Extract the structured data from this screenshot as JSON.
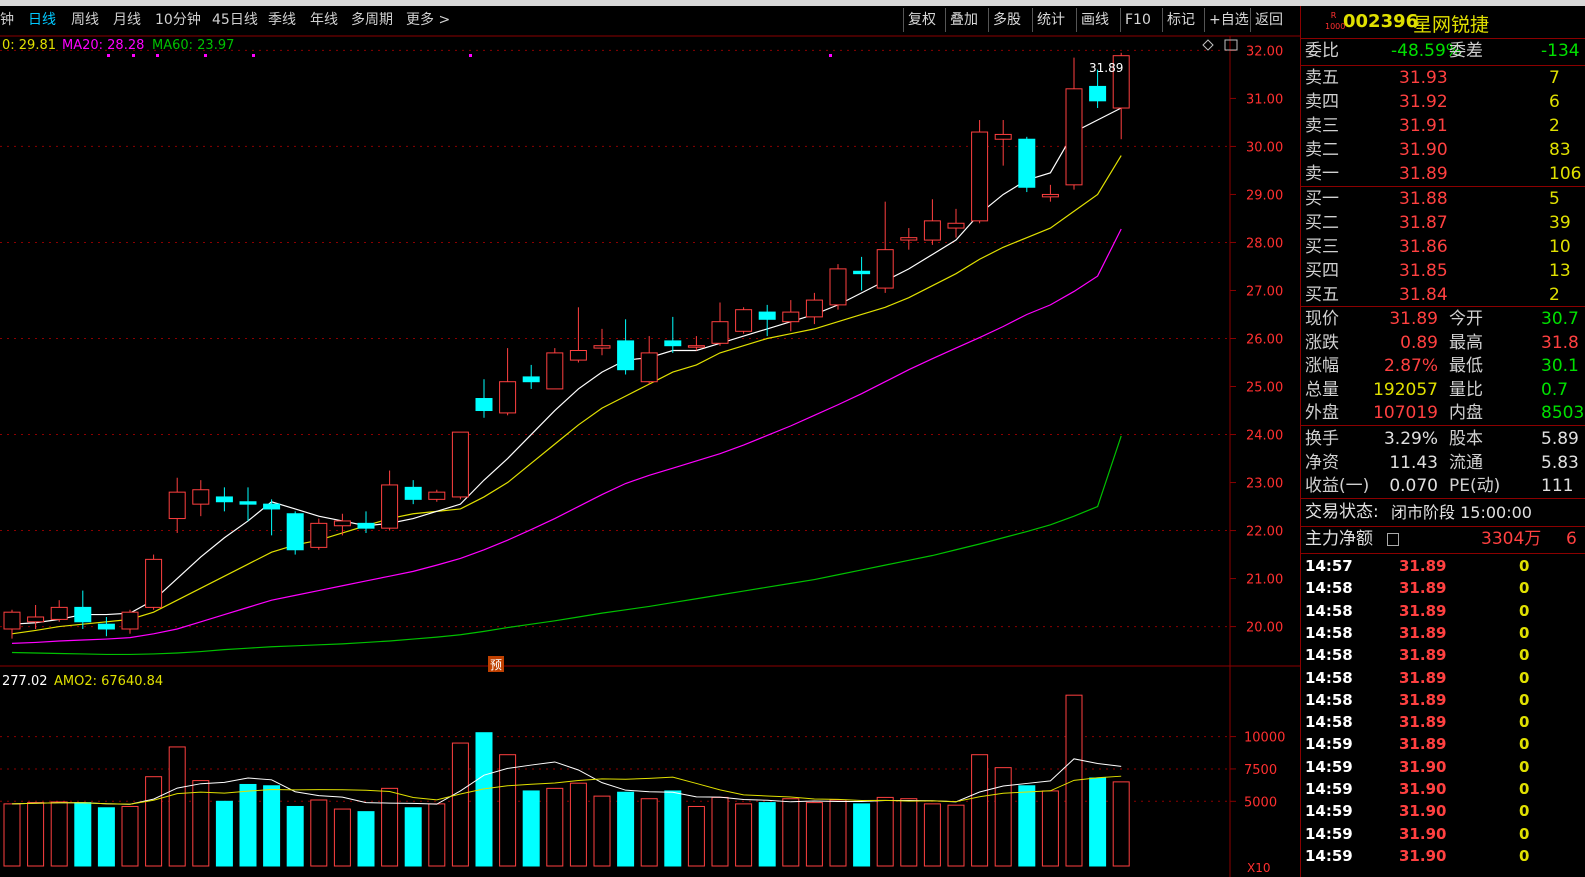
{
  "toolbar": {
    "periods": [
      "分钟",
      "日线",
      "周线",
      "月线",
      "10分钟",
      "45日线",
      "季线",
      "年线",
      "多周期",
      "更多 >"
    ],
    "active_period": "日线",
    "buttons": [
      "复权",
      "叠加",
      "多股",
      "统计",
      "画线",
      "F10",
      "标记",
      "+自选",
      "返回"
    ]
  },
  "indicators": {
    "ma10": "0: 29.81",
    "ma20": "MA20: 28.28",
    "ma60": "MA60: 23.97",
    "volume_legend_a": "277.02",
    "volume_legend_b": "AMO2: 67640.84",
    "yu_marker": "预",
    "high_label": "31.89",
    "x10_label": "X10"
  },
  "colors": {
    "up": "#ff4040",
    "down": "#00ffff",
    "ma5": "#ffffff",
    "ma10": "#e0e000",
    "ma20": "#ff00ff",
    "ma60": "#00c000",
    "grid": "#8b0000",
    "axis_text": "#ff3030"
  },
  "price_axis": [
    "32.00",
    "31.00",
    "30.00",
    "29.00",
    "28.00",
    "27.00",
    "26.00",
    "25.00",
    "24.00",
    "23.00",
    "22.00",
    "21.00",
    "20.00"
  ],
  "volume_axis": [
    "10000",
    "7500",
    "5000"
  ],
  "chart_data": {
    "type": "candlestick",
    "ylim": [
      19.2,
      32.3
    ],
    "candles": [
      {
        "o": 19.95,
        "c": 20.3,
        "h": 20.35,
        "l": 19.75
      },
      {
        "o": 20.1,
        "c": 20.2,
        "h": 20.45,
        "l": 19.95
      },
      {
        "o": 20.15,
        "c": 20.4,
        "h": 20.55,
        "l": 20.1
      },
      {
        "o": 20.4,
        "c": 20.1,
        "h": 20.75,
        "l": 19.95
      },
      {
        "o": 20.05,
        "c": 19.95,
        "h": 20.2,
        "l": 19.8
      },
      {
        "o": 19.95,
        "c": 20.3,
        "h": 20.35,
        "l": 19.85
      },
      {
        "o": 20.4,
        "c": 21.4,
        "h": 21.5,
        "l": 20.35
      },
      {
        "o": 22.25,
        "c": 22.8,
        "h": 23.1,
        "l": 21.95
      },
      {
        "o": 22.55,
        "c": 22.85,
        "h": 23.05,
        "l": 22.3
      },
      {
        "o": 22.7,
        "c": 22.6,
        "h": 22.9,
        "l": 22.4
      },
      {
        "o": 22.6,
        "c": 22.55,
        "h": 22.9,
        "l": 22.2
      },
      {
        "o": 22.55,
        "c": 22.45,
        "h": 22.65,
        "l": 21.9
      },
      {
        "o": 22.35,
        "c": 21.6,
        "h": 22.4,
        "l": 21.5
      },
      {
        "o": 21.65,
        "c": 22.15,
        "h": 22.25,
        "l": 21.6
      },
      {
        "o": 22.1,
        "c": 22.2,
        "h": 22.35,
        "l": 21.9
      },
      {
        "o": 22.15,
        "c": 22.05,
        "h": 22.4,
        "l": 21.95
      },
      {
        "o": 22.05,
        "c": 22.95,
        "h": 23.25,
        "l": 22.0
      },
      {
        "o": 22.9,
        "c": 22.65,
        "h": 23.05,
        "l": 22.55
      },
      {
        "o": 22.65,
        "c": 22.8,
        "h": 22.85,
        "l": 22.6
      },
      {
        "o": 22.7,
        "c": 24.05,
        "h": 24.05,
        "l": 22.65
      },
      {
        "o": 24.75,
        "c": 24.5,
        "h": 25.15,
        "l": 24.35
      },
      {
        "o": 24.45,
        "c": 25.1,
        "h": 25.8,
        "l": 24.4
      },
      {
        "o": 25.2,
        "c": 25.1,
        "h": 25.45,
        "l": 24.95
      },
      {
        "o": 24.95,
        "c": 25.7,
        "h": 25.8,
        "l": 24.95
      },
      {
        "o": 25.55,
        "c": 25.75,
        "h": 26.65,
        "l": 25.5
      },
      {
        "o": 25.8,
        "c": 25.85,
        "h": 26.2,
        "l": 25.65
      },
      {
        "o": 25.95,
        "c": 25.35,
        "h": 26.4,
        "l": 25.25
      },
      {
        "o": 25.1,
        "c": 25.7,
        "h": 26.05,
        "l": 25.05
      },
      {
        "o": 25.95,
        "c": 25.85,
        "h": 26.45,
        "l": 25.7
      },
      {
        "o": 25.85,
        "c": 25.85,
        "h": 26.05,
        "l": 25.75
      },
      {
        "o": 25.9,
        "c": 26.35,
        "h": 26.75,
        "l": 25.85
      },
      {
        "o": 26.15,
        "c": 26.6,
        "h": 26.65,
        "l": 26.1
      },
      {
        "o": 26.55,
        "c": 26.4,
        "h": 26.7,
        "l": 26.05
      },
      {
        "o": 26.35,
        "c": 26.55,
        "h": 26.8,
        "l": 26.15
      },
      {
        "o": 26.45,
        "c": 26.8,
        "h": 26.95,
        "l": 26.3
      },
      {
        "o": 26.7,
        "c": 27.45,
        "h": 27.55,
        "l": 26.6
      },
      {
        "o": 27.4,
        "c": 27.35,
        "h": 27.7,
        "l": 27.0
      },
      {
        "o": 27.05,
        "c": 27.85,
        "h": 28.85,
        "l": 26.95
      },
      {
        "o": 28.05,
        "c": 28.1,
        "h": 28.3,
        "l": 27.85
      },
      {
        "o": 28.05,
        "c": 28.45,
        "h": 28.9,
        "l": 27.95
      },
      {
        "o": 28.3,
        "c": 28.4,
        "h": 28.7,
        "l": 28.1
      },
      {
        "o": 28.45,
        "c": 30.3,
        "h": 30.55,
        "l": 28.4
      },
      {
        "o": 30.15,
        "c": 30.25,
        "h": 30.55,
        "l": 29.6
      },
      {
        "o": 30.15,
        "c": 29.15,
        "h": 30.2,
        "l": 29.05
      },
      {
        "o": 28.95,
        "c": 29.0,
        "h": 29.2,
        "l": 28.85
      },
      {
        "o": 29.2,
        "c": 31.2,
        "h": 31.85,
        "l": 29.1
      },
      {
        "o": 31.25,
        "c": 30.95,
        "h": 31.6,
        "l": 30.8
      },
      {
        "o": 30.8,
        "c": 31.89,
        "h": 31.95,
        "l": 30.15
      }
    ],
    "volume": [
      4800,
      4900,
      4950,
      4900,
      4500,
      4600,
      6900,
      9200,
      6600,
      5000,
      6300,
      6200,
      4600,
      5100,
      4400,
      4200,
      6000,
      4500,
      4800,
      9500,
      10300,
      8600,
      5800,
      6000,
      6400,
      5400,
      5700,
      5200,
      5800,
      4600,
      5300,
      4800,
      4900,
      5200,
      4900,
      5100,
      4800,
      5300,
      5200,
      4800,
      4700,
      8600,
      7600,
      6200,
      5800,
      13200,
      6800,
      6500
    ],
    "ma5": [
      20.05,
      20.08,
      20.15,
      20.25,
      20.25,
      20.28,
      20.55,
      21.0,
      21.45,
      21.85,
      22.2,
      22.6,
      22.45,
      22.3,
      22.2,
      22.1,
      22.15,
      22.25,
      22.4,
      22.55,
      23.05,
      23.5,
      24.0,
      24.5,
      24.95,
      25.3,
      25.55,
      25.6,
      25.75,
      25.75,
      25.9,
      26.05,
      26.2,
      26.35,
      26.5,
      26.7,
      26.95,
      27.2,
      27.45,
      27.75,
      28.05,
      28.6,
      29.0,
      29.3,
      29.45,
      30.3,
      30.55,
      30.8
    ],
    "ma10": [
      19.85,
      19.92,
      20.0,
      20.05,
      20.1,
      20.15,
      20.3,
      20.55,
      20.8,
      21.05,
      21.3,
      21.55,
      21.7,
      21.8,
      21.95,
      22.1,
      22.25,
      22.35,
      22.4,
      22.45,
      22.7,
      23.0,
      23.4,
      23.8,
      24.2,
      24.55,
      24.8,
      25.05,
      25.3,
      25.45,
      25.7,
      25.85,
      26.0,
      26.1,
      26.2,
      26.35,
      26.5,
      26.65,
      26.85,
      27.1,
      27.35,
      27.65,
      27.9,
      28.1,
      28.3,
      28.65,
      29.0,
      29.81
    ],
    "ma20": [
      19.65,
      19.67,
      19.7,
      19.72,
      19.74,
      19.77,
      19.85,
      19.95,
      20.1,
      20.25,
      20.4,
      20.55,
      20.65,
      20.75,
      20.85,
      20.95,
      21.05,
      21.15,
      21.28,
      21.42,
      21.6,
      21.8,
      22.02,
      22.25,
      22.5,
      22.75,
      22.98,
      23.15,
      23.3,
      23.45,
      23.6,
      23.78,
      23.98,
      24.18,
      24.4,
      24.62,
      24.85,
      25.1,
      25.35,
      25.58,
      25.8,
      26.02,
      26.25,
      26.5,
      26.7,
      26.98,
      27.3,
      28.28
    ],
    "ma60": [
      19.46,
      19.45,
      19.44,
      19.43,
      19.42,
      19.42,
      19.43,
      19.45,
      19.48,
      19.52,
      19.55,
      19.58,
      19.6,
      19.62,
      19.64,
      19.67,
      19.7,
      19.74,
      19.78,
      19.83,
      19.9,
      19.98,
      20.05,
      20.12,
      20.2,
      20.28,
      20.35,
      20.42,
      20.5,
      20.58,
      20.66,
      20.74,
      20.82,
      20.9,
      20.98,
      21.08,
      21.18,
      21.28,
      21.38,
      21.48,
      21.6,
      21.72,
      21.85,
      21.98,
      22.12,
      22.3,
      22.5,
      23.97
    ]
  },
  "quote": {
    "badge_top": "R",
    "badge_bottom": "1000",
    "code": "002396",
    "name": "星网锐捷",
    "weibi_label": "委比",
    "weibi_value": "-48.59%",
    "weicha_label": "委差",
    "weicha_value": "-134",
    "asks": [
      {
        "label": "卖五",
        "price": "31.93",
        "vol": "7"
      },
      {
        "label": "卖四",
        "price": "31.92",
        "vol": "6"
      },
      {
        "label": "卖三",
        "price": "31.91",
        "vol": "2"
      },
      {
        "label": "卖二",
        "price": "31.90",
        "vol": "83"
      },
      {
        "label": "卖一",
        "price": "31.89",
        "vol": "106"
      }
    ],
    "bids": [
      {
        "label": "买一",
        "price": "31.88",
        "vol": "5"
      },
      {
        "label": "买二",
        "price": "31.87",
        "vol": "39"
      },
      {
        "label": "买三",
        "price": "31.86",
        "vol": "10"
      },
      {
        "label": "买四",
        "price": "31.85",
        "vol": "13"
      },
      {
        "label": "买五",
        "price": "31.84",
        "vol": "2"
      }
    ],
    "stats": [
      {
        "l1": "现价",
        "v1": "31.89",
        "c1": "#ff4040",
        "l2": "今开",
        "v2": "30.7",
        "c2": "#00e000"
      },
      {
        "l1": "涨跌",
        "v1": "0.89",
        "c1": "#ff4040",
        "l2": "最高",
        "v2": "31.8",
        "c2": "#ff4040"
      },
      {
        "l1": "涨幅",
        "v1": "2.87%",
        "c1": "#ff4040",
        "l2": "最低",
        "v2": "30.1",
        "c2": "#00e000"
      },
      {
        "l1": "总量",
        "v1": "192057",
        "c1": "#e0e000",
        "l2": "量比",
        "v2": "0.7",
        "c2": "#00e000"
      },
      {
        "l1": "外盘",
        "v1": "107019",
        "c1": "#ff4040",
        "l2": "内盘",
        "v2": "8503",
        "c2": "#00e000"
      }
    ],
    "stats2": [
      {
        "l1": "换手",
        "v1": "3.29%",
        "l2": "股本",
        "v2": "5.89"
      },
      {
        "l1": "净资",
        "v1": "11.43",
        "l2": "流通",
        "v2": "5.83"
      },
      {
        "l1": "收益(一)",
        "v1": "0.070",
        "l2": "PE(动)",
        "v2": "111"
      }
    ],
    "status_label": "交易状态:",
    "status_value": "闭市阶段 15:00:00",
    "main_flow_label": "主力净额",
    "main_flow_value": "3304万",
    "main_flow_extra": "6"
  },
  "ticks": [
    {
      "time": "14:57",
      "price": "31.89",
      "vol": "0"
    },
    {
      "time": "14:58",
      "price": "31.89",
      "vol": "0"
    },
    {
      "time": "14:58",
      "price": "31.89",
      "vol": "0"
    },
    {
      "time": "14:58",
      "price": "31.89",
      "vol": "0"
    },
    {
      "time": "14:58",
      "price": "31.89",
      "vol": "0"
    },
    {
      "time": "14:58",
      "price": "31.89",
      "vol": "0"
    },
    {
      "time": "14:58",
      "price": "31.89",
      "vol": "0"
    },
    {
      "time": "14:58",
      "price": "31.89",
      "vol": "0"
    },
    {
      "time": "14:59",
      "price": "31.89",
      "vol": "0"
    },
    {
      "time": "14:59",
      "price": "31.90",
      "vol": "0"
    },
    {
      "time": "14:59",
      "price": "31.90",
      "vol": "0"
    },
    {
      "time": "14:59",
      "price": "31.90",
      "vol": "0"
    },
    {
      "time": "14:59",
      "price": "31.90",
      "vol": "0"
    },
    {
      "time": "14:59",
      "price": "31.90",
      "vol": "0"
    }
  ]
}
